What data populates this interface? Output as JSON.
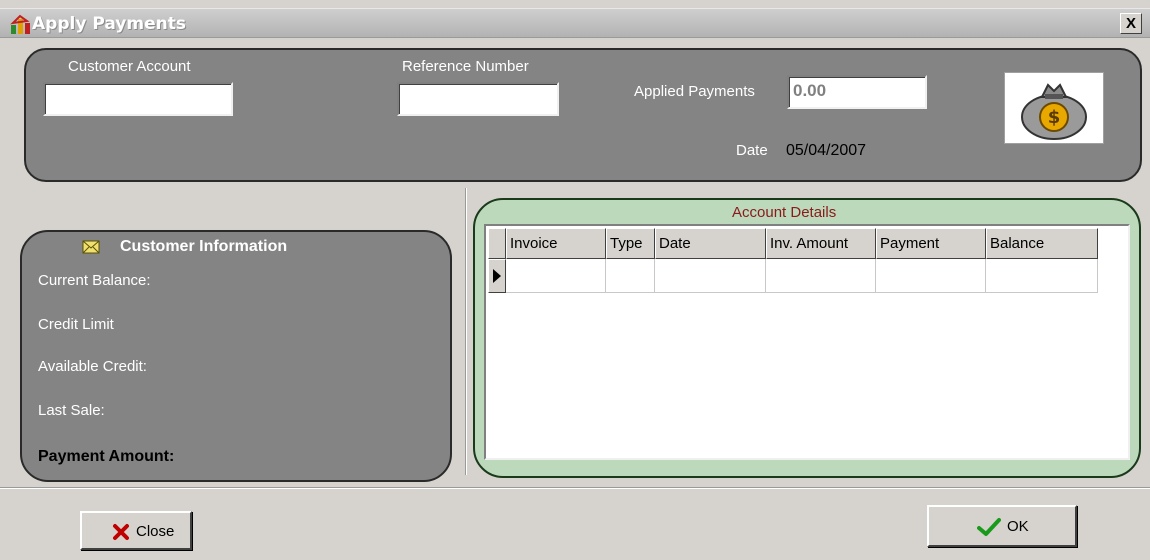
{
  "window": {
    "title": "Apply Payments",
    "close_glyph": "X",
    "icon": "app-chart-icon"
  },
  "header": {
    "customer_account_label": "Customer Account",
    "customer_account_value": "",
    "reference_number_label": "Reference Number",
    "reference_number_value": "",
    "applied_payments_label": "Applied Payments",
    "applied_payments_value": "0.00",
    "date_label": "Date",
    "date_value": "05/04/2007",
    "image_icon": "money-bag-icon"
  },
  "customer_info": {
    "title": "Customer Information",
    "icon": "envelope-icon",
    "current_balance_label": "Current Balance:",
    "credit_limit_label": "Credit Limit",
    "available_credit_label": "Available Credit:",
    "last_sale_label": "Last Sale:",
    "payment_amount_label": "Payment Amount:"
  },
  "account_details": {
    "title": "Account Details",
    "columns": [
      "Invoice",
      "Type",
      "Date",
      "Inv. Amount",
      "Payment",
      "Balance"
    ],
    "rows": [
      [
        "",
        "",
        "",
        "",
        "",
        ""
      ]
    ]
  },
  "buttons": {
    "close_label": "Close",
    "close_icon": "red-x-icon",
    "ok_label": "OK",
    "ok_icon": "green-check-icon"
  },
  "colors": {
    "panel": "#848484",
    "grid_panel": "#bcd9bc",
    "title_text": "#8b1a1a"
  }
}
